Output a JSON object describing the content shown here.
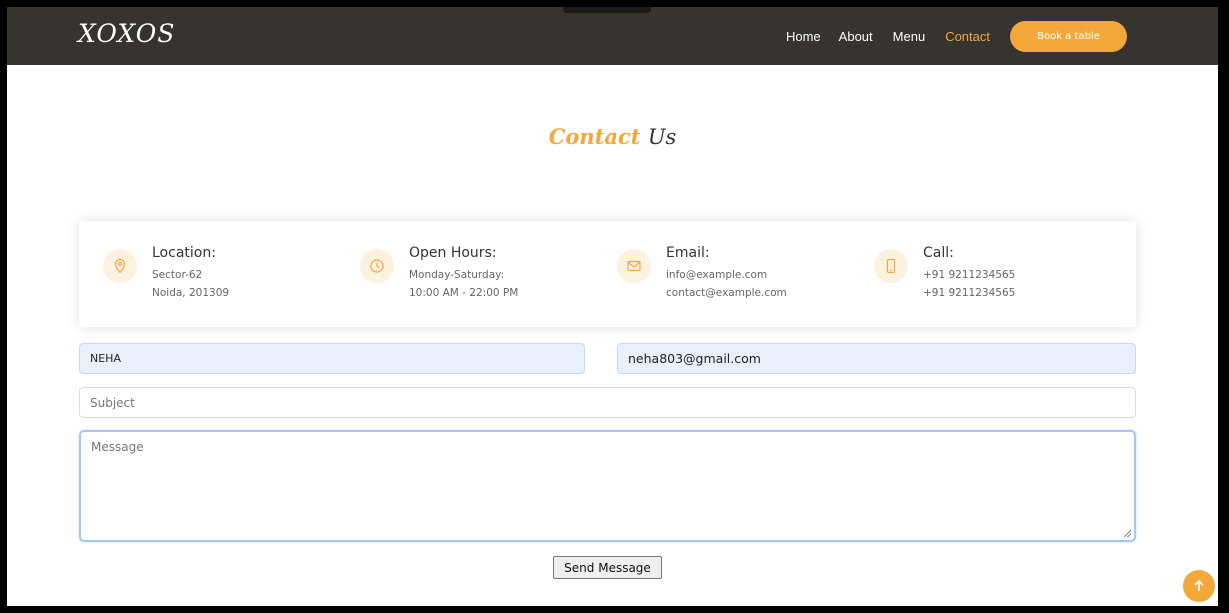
{
  "brand": {
    "logo": "XOXOS",
    "accent": "#f3a83b",
    "header_bg": "#37332f"
  },
  "nav": {
    "items": [
      "Home",
      "About",
      "Menu",
      "Contact"
    ],
    "active": "Contact",
    "cta_label": "Book a table"
  },
  "section": {
    "title_part1": "Contact",
    "title_part2": "Us"
  },
  "info": [
    {
      "icon": "location-pin-icon",
      "heading": "Location:",
      "line1": "Sector-62",
      "line2": "Noida, 201309"
    },
    {
      "icon": "clock-icon",
      "heading": "Open Hours:",
      "line1": "Monday-Saturday:",
      "line2": "10:00 AM - 22:00 PM"
    },
    {
      "icon": "envelope-icon",
      "heading": "Email:",
      "line1": "info@example.com",
      "line2": "contact@example.com"
    },
    {
      "icon": "phone-icon",
      "heading": "Call:",
      "line1": "+91 9211234565",
      "line2": "+91 9211234565"
    }
  ],
  "form": {
    "name_value": "NEHA",
    "email_value": "neha803@gmail.com",
    "subject_placeholder": "Subject",
    "message_placeholder": "Message",
    "submit_label": "Send Message"
  }
}
